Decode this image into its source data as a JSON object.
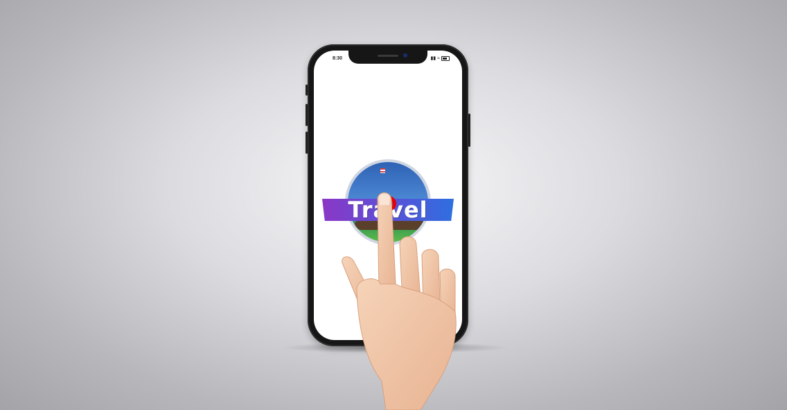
{
  "status_bar": {
    "time": "8:30",
    "signal_icon": "signal-icon",
    "wifi_icon": "wifi-icon",
    "battery_icon": "battery-icon"
  },
  "app": {
    "logo_text": "Travel",
    "logo_icon": "travel-globe-icon"
  },
  "overlay": {
    "tap_marker": "tap-indicator",
    "hand": "pointing-hand"
  },
  "colors": {
    "ribbon_start": "#8b37c6",
    "ribbon_end": "#2f6fe0",
    "tap_marker": "#e60000"
  }
}
